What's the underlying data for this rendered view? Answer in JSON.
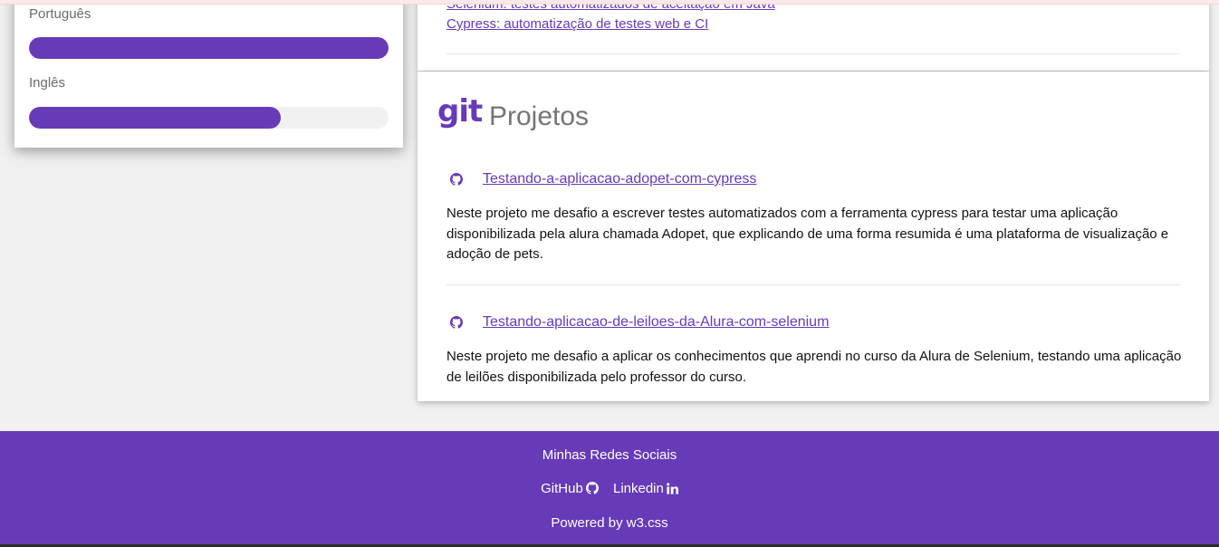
{
  "skills": {
    "items": [
      {
        "label": "Português",
        "level": 1.0
      },
      {
        "label": "Inglês",
        "level": 0.7
      }
    ]
  },
  "courses": {
    "links": [
      "Selenium: testes automatizados de aceitação em Java",
      "Cypress: automatização de testes web e CI"
    ]
  },
  "projects": {
    "logo_text": "git",
    "title": "Projetos",
    "items": [
      {
        "name": "Testando-a-aplicacao-adopet-com-cypress",
        "description": "Neste projeto me desafio a escrever testes automatizados com a ferramenta cypress para testar uma aplicação disponibilizada pela alura chamada Adopet, que explicando de uma forma resumida é uma plataforma de visualização e adoção de pets."
      },
      {
        "name": "Testando-aplicacao-de-leiloes-da-Alura-com-selenium",
        "description": "Neste projeto me desafio a aplicar os conhecimentos que aprendi no curso da Alura de Selenium, testando uma aplicação de leilões disponibilizada pelo professor do curso."
      }
    ]
  },
  "footer": {
    "heading": "Minhas Redes Sociais",
    "github_label": "GitHub",
    "linkedin_label": "Linkedin",
    "powered_by": "Powered by w3.css"
  },
  "colors": {
    "accent": "#673ab7",
    "background": "#f1f1f1"
  },
  "icons": [
    "github-icon",
    "linkedin-icon",
    "git-logo"
  ]
}
